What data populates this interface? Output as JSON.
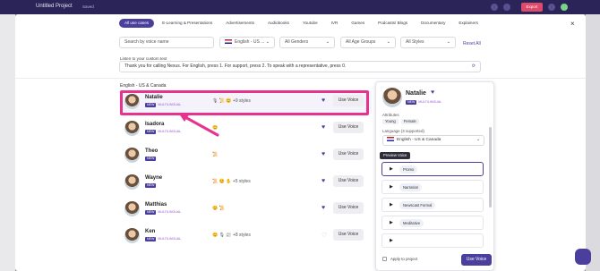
{
  "app": {
    "project_title": "Untitled Project",
    "saved": "Saved",
    "export_label": "Export"
  },
  "tabs": [
    "All use cases",
    "E-Learning & Presentations",
    "Advertisements",
    "Audiobooks",
    "Youtube",
    "IVR",
    "Games",
    "Podcasts/ Blogs",
    "Documentary",
    "Explainers"
  ],
  "filters": {
    "search_placeholder": "Search by voice name",
    "language": "English - US ...",
    "genders": "All Genders",
    "age_groups": "All Age Groups",
    "styles": "All Styles",
    "reset": "Reset All"
  },
  "custom_text": {
    "label": "Listen to your custom text",
    "value": "Thank you for calling Nexus. For English, press 1. For support, press 2. To speak with a representative, press 0."
  },
  "region": "English - US & Canada",
  "voices": [
    {
      "name": "Natalie",
      "new": "NEW",
      "multi": "MULTILINGUAL",
      "extra": "🎙 📜 😊  +9 styles",
      "favorite": true,
      "use": "Use Voice"
    },
    {
      "name": "Isadora",
      "new": "NEW",
      "multi": "MULTILINGUAL",
      "extra": "😊",
      "favorite": true,
      "use": "Use Voice"
    },
    {
      "name": "Theo",
      "new": "NEW",
      "multi": "",
      "extra": "📜",
      "favorite": true,
      "use": "Use Voice"
    },
    {
      "name": "Wayne",
      "new": "NEW",
      "multi": "",
      "extra": "📜 😊 ✋  +5 styles",
      "favorite": true,
      "use": "Use Voice"
    },
    {
      "name": "Matthias",
      "new": "NEW",
      "multi": "MULTILINGUAL",
      "extra": "😊 📜",
      "favorite": true,
      "use": "Use Voice"
    },
    {
      "name": "Ken",
      "new": "NEW",
      "multi": "MULTILINGUAL",
      "extra": "😊 🎙 📰  +8 styles",
      "favorite": false,
      "use": "Use Voice"
    }
  ],
  "panel": {
    "name": "Natalie",
    "new": "NEW",
    "multi": "MULTILINGUAL",
    "attributes_label": "Attributes",
    "attributes": [
      "Young",
      "Female"
    ],
    "language_label": "Language (3 supported)",
    "language": "English - US & Canada",
    "tooltip": "Preview Voice",
    "styles": [
      "Promo",
      "Narration",
      "Newscast Formal",
      "Meditative",
      ""
    ],
    "apply_label": "Apply to project",
    "use_label": "Use Voice"
  },
  "colors": {
    "accent": "#4b3f9e",
    "highlight": "#e6338e"
  }
}
